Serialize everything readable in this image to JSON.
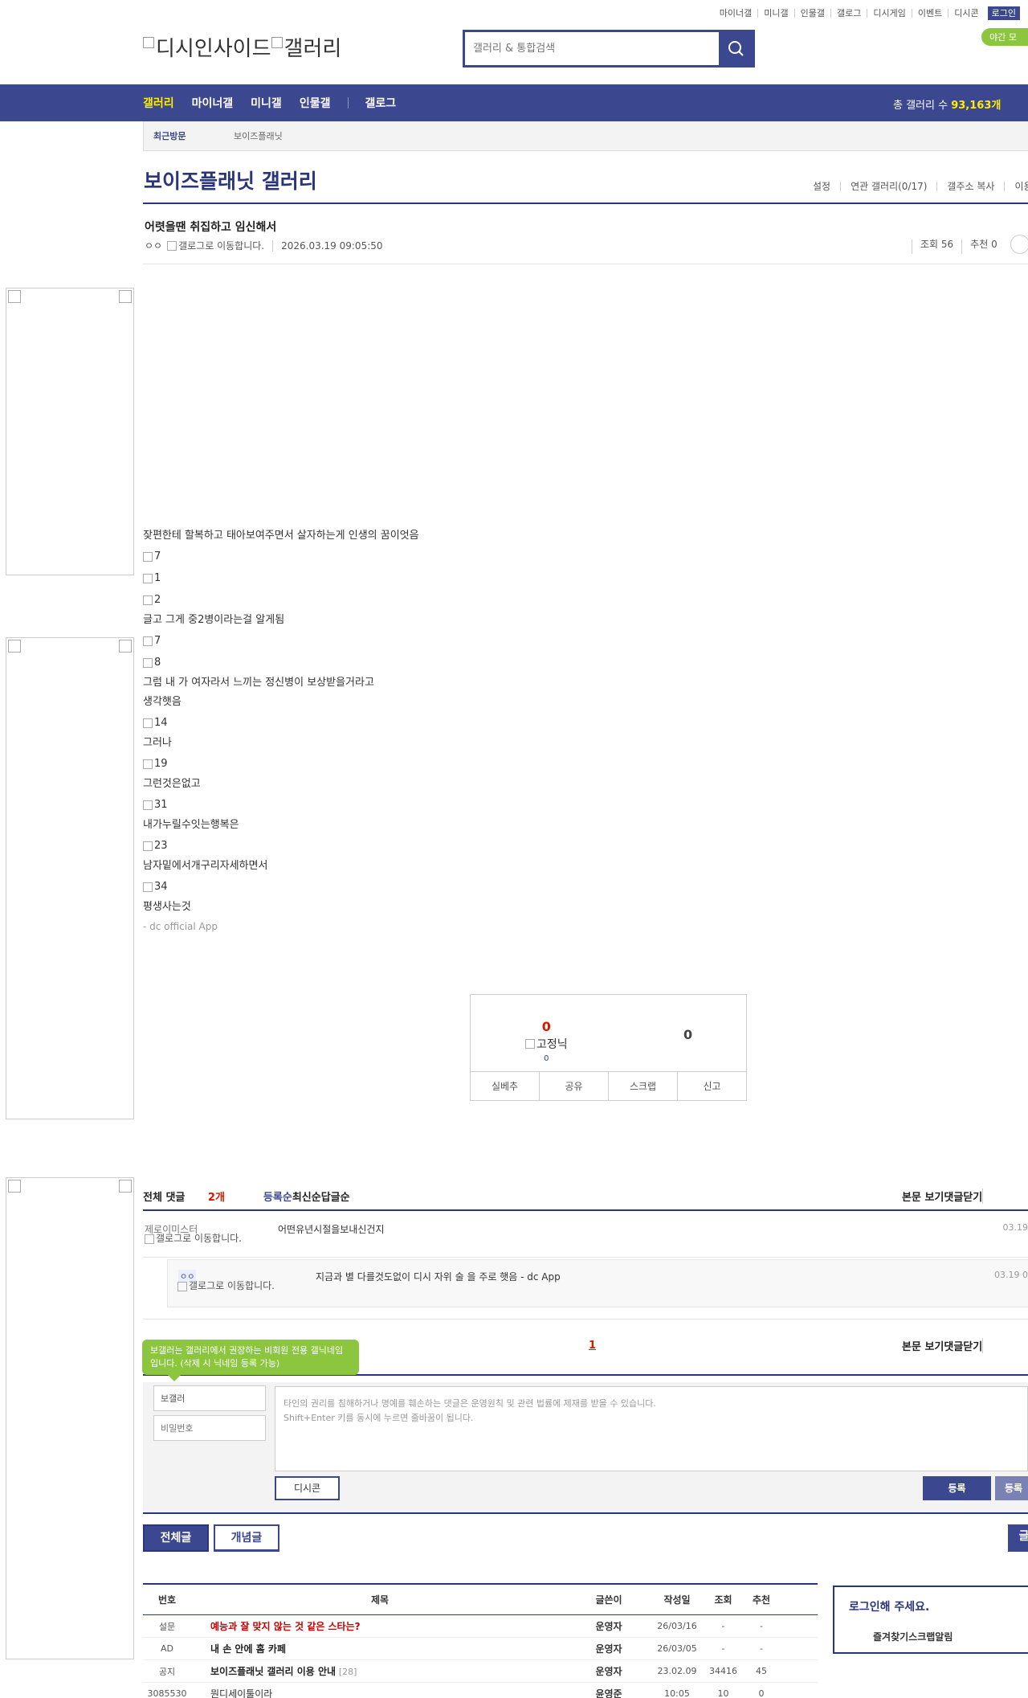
{
  "util": {
    "links": [
      "마이너갤",
      "미니갤",
      "인물갤",
      "갤로그",
      "디시게임",
      "이벤트",
      "디시콘"
    ],
    "login": "로그인",
    "night": "야간 모"
  },
  "logo": {
    "site": "디시인사이드",
    "gallery": "갤러리"
  },
  "search": {
    "placeholder": "갤러리 & 통합검색"
  },
  "gnb": {
    "menu": [
      "갤러리",
      "마이너갤",
      "미니갤",
      "인물갤"
    ],
    "gallog": "갤로그",
    "total_label": "총 갤러리 수",
    "total_value": "93,163개"
  },
  "recent": {
    "label": "최근방문",
    "gallery": "보이즈플래닛"
  },
  "gallery": {
    "title": "보이즈플래닛 갤러리",
    "options": [
      "설정",
      "연관 갤러리(0/17)",
      "갤주소 복사",
      "이용"
    ]
  },
  "post": {
    "title": "어렷을땐 취집하고 임신해서",
    "nick": "ㅇㅇ",
    "gallog_icon_alt": "갤로그로 이동합니다.",
    "date": "2026.03.19 09:05:50",
    "views": "조회 56",
    "recommend": "추천 0"
  },
  "body": {
    "lines": [
      {
        "type": "text",
        "v": "잦편한테 할복하고 태아보여주면서 살자하는게 인생의 꿈이엇음"
      },
      {
        "type": "img",
        "v": "7"
      },
      {
        "type": "img",
        "v": "1"
      },
      {
        "type": "img",
        "v": "2"
      },
      {
        "type": "text",
        "v": "글고 그게 중2병이라는걸 알게됨"
      },
      {
        "type": "img",
        "v": "7"
      },
      {
        "type": "img",
        "v": "8"
      },
      {
        "type": "text",
        "v": "그럼 내 가 여자라서 느끼는 정신병이 보상받을거라고"
      },
      {
        "type": "text",
        "v": "생각햇음"
      },
      {
        "type": "img",
        "v": "14"
      },
      {
        "type": "text",
        "v": "그러나"
      },
      {
        "type": "img",
        "v": "19"
      },
      {
        "type": "text",
        "v": "그런것은없고"
      },
      {
        "type": "img",
        "v": "31"
      },
      {
        "type": "text",
        "v": "내가누릴수잇는행복은"
      },
      {
        "type": "img",
        "v": "23"
      },
      {
        "type": "text",
        "v": "남자밑에서개구리자세하면서"
      },
      {
        "type": "img",
        "v": "34"
      },
      {
        "type": "text",
        "v": "평생사는것"
      }
    ],
    "app": "- dc official App"
  },
  "recommend_box": {
    "up": "0",
    "fixed_alt": "고정닉",
    "fixed_count": "0",
    "down": "0",
    "buttons": [
      "실베추",
      "공유",
      "스크랩",
      "신고"
    ]
  },
  "comments": {
    "total_label": "전체 댓글",
    "total_count": "2개",
    "sorts": [
      "등록순",
      "최신순",
      "답글순"
    ],
    "right": [
      "본문 보기",
      "댓글닫기"
    ],
    "items": [
      {
        "nick": "제로이미스터",
        "icon_alt": "갤로그로 이동합니다.",
        "text": "어떤유년시절을보내신건지",
        "date": "03.19"
      },
      {
        "nick": "ㅇㅇ",
        "icon_alt": "갤로그로 이동합니다.",
        "text": "지금과 별 다를것도없이 디시 자위 술 을 주로 햇음 - dc App",
        "date": "03.19 0"
      }
    ],
    "page": "1"
  },
  "write": {
    "tooltip": "보갤러는 갤러리에서 권장하는 비회원 전용 갤닉네임입니다. (삭제 시 닉네임 등록 가능)",
    "nick_value": "보갤러",
    "pw_placeholder": "비밀번호",
    "textarea_line1": "타인의 권리를 침해하거나 명예를 훼손하는 댓글은 운영원칙 및 관련 법률에 제재를 받을 수 있습니다.",
    "textarea_line2": "Shift+Enter 키를 동시에 누르면 줄바꿈이 됩니다.",
    "dccon": "디시콘",
    "submit": "등록",
    "submit2": "등록"
  },
  "tabs": {
    "all": "전체글",
    "concept": "개념글",
    "write": "글"
  },
  "list": {
    "headers": [
      "번호",
      "제목",
      "글쓴이",
      "작성일",
      "조회",
      "추천"
    ],
    "rows": [
      {
        "no": "설문",
        "title": "예능과 잘 맞지 않는 것 같은 스타는?",
        "style": "red",
        "cmt": "",
        "writer": "운영자",
        "date": "26/03/16",
        "views": "-",
        "rec": "-"
      },
      {
        "no": "AD",
        "title": "내 손 안에 홈 카페",
        "style": "bold",
        "cmt": "",
        "writer": "운영자",
        "date": "26/03/05",
        "views": "-",
        "rec": "-"
      },
      {
        "no": "공지",
        "title": "보이즈플래닛 갤러리 이용 안내",
        "style": "bold",
        "cmt": "[28]",
        "writer": "운영자",
        "date": "23.02.09",
        "views": "34416",
        "rec": "45"
      },
      {
        "no": "3085530",
        "title": "뭔디세이툴이라",
        "style": "normal",
        "cmt": "",
        "writer": "윤영준",
        "date": "10:05",
        "views": "10",
        "rec": "0"
      }
    ]
  },
  "side": {
    "title": "로그인해 주세요.",
    "links": [
      "즐겨찾기",
      "스크랩",
      "알림"
    ]
  }
}
